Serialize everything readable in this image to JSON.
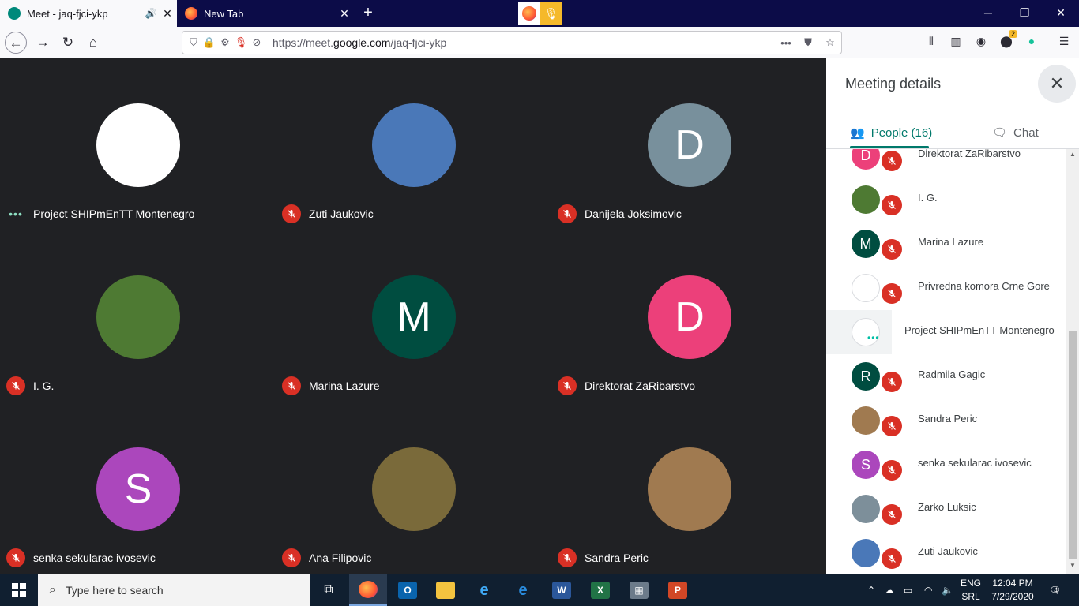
{
  "browser": {
    "tabs": [
      {
        "title": "Meet - jaq-fjci-ykp",
        "active": true
      },
      {
        "title": "New Tab",
        "active": false
      }
    ],
    "url_prefix": "https://meet.",
    "url_domain": "google.com",
    "url_path": "/jaq-fjci-ykp",
    "new_tab": "+",
    "badge_count": "2"
  },
  "meeting": {
    "grid": [
      {
        "name": "Project SHIPmEnTT Montenegro",
        "initial": "",
        "color": "#ffffff",
        "speaking": true
      },
      {
        "name": "Zuti Jaukovic",
        "initial": "",
        "color": "#4a78b8",
        "speaking": false
      },
      {
        "name": "Danijela Joksimovic",
        "initial": "D",
        "color": "#78909c",
        "speaking": false
      },
      {
        "name": "I. G.",
        "initial": "",
        "color": "#4e7a33",
        "speaking": false
      },
      {
        "name": "Marina Lazure",
        "initial": "M",
        "color": "#004d40",
        "speaking": false
      },
      {
        "name": "Direktorat ZaRibarstvo",
        "initial": "D",
        "color": "#ec407a",
        "speaking": false
      },
      {
        "name": "senka sekularac ivosevic",
        "initial": "S",
        "color": "#ab47bc",
        "speaking": false
      },
      {
        "name": "Ana Filipovic",
        "initial": "",
        "color": "#7a6a3a",
        "speaking": false
      },
      {
        "name": "Sandra Peric",
        "initial": "",
        "color": "#a07a50",
        "speaking": false
      }
    ]
  },
  "panel": {
    "title": "Meeting details",
    "tab_people": "People (16)",
    "tab_chat": "Chat",
    "people": [
      {
        "name": "Direktorat ZaRibarstvo",
        "initial": "D",
        "color": "#ec407a"
      },
      {
        "name": "I. G.",
        "initial": "",
        "color": "#4e7a33"
      },
      {
        "name": "Marina Lazure",
        "initial": "M",
        "color": "#004d40"
      },
      {
        "name": "Privredna komora Crne Gore",
        "initial": "",
        "color": "#ffffff"
      },
      {
        "name": "Project SHIPmEnTT Montenegro",
        "initial": "",
        "color": "#ffffff",
        "speaking": true
      },
      {
        "name": "Radmila Gagic",
        "initial": "R",
        "color": "#004d40"
      },
      {
        "name": "Sandra Peric",
        "initial": "",
        "color": "#a07a50"
      },
      {
        "name": "senka sekularac ivosevic",
        "initial": "S",
        "color": "#ab47bc"
      },
      {
        "name": "Zarko Luksic",
        "initial": "",
        "color": "#7d8f9a"
      },
      {
        "name": "Zuti Jaukovic",
        "initial": "",
        "color": "#4a78b8"
      }
    ]
  },
  "taskbar": {
    "search_placeholder": "Type here to search",
    "lang_top": "ENG",
    "lang_bottom": "SRL",
    "time": "12:04 PM",
    "date": "7/29/2020",
    "notif_count": "4"
  }
}
